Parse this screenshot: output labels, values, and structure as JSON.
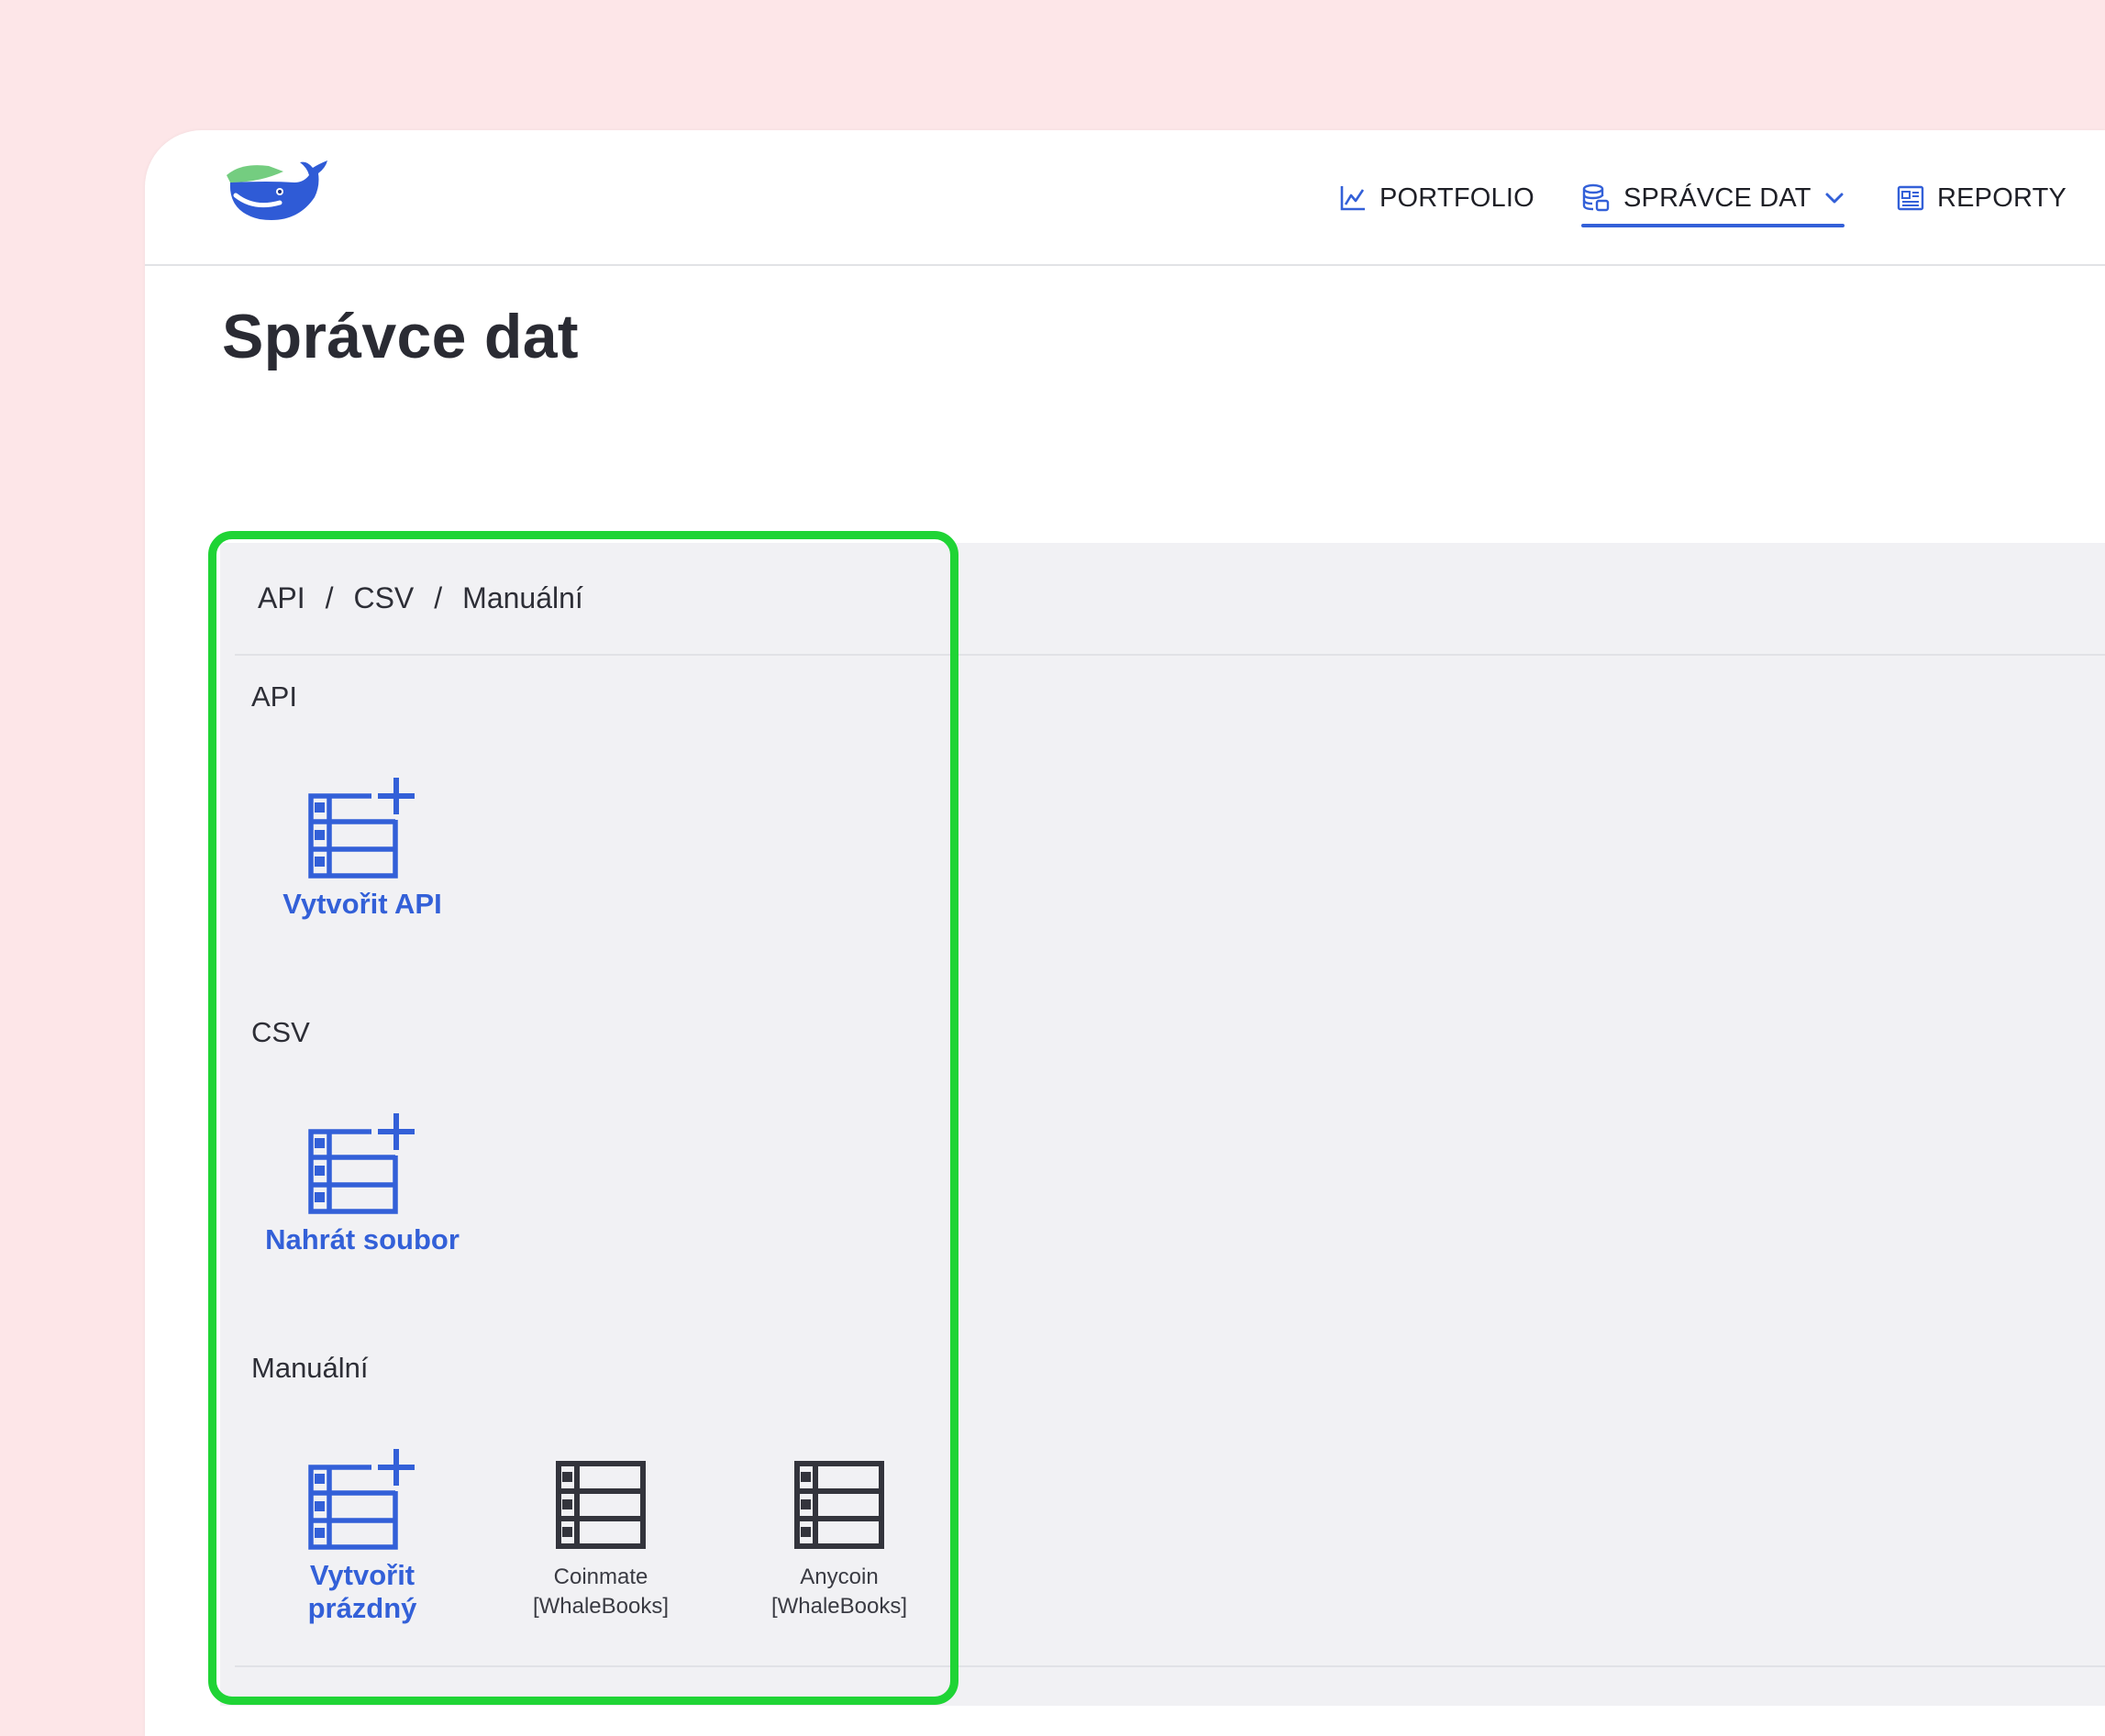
{
  "nav": {
    "items": [
      {
        "label": "PORTFOLIO",
        "icon": "chart-line-icon"
      },
      {
        "label": "SPRÁVCE DAT",
        "icon": "database-icon",
        "active": true
      },
      {
        "label": "REPORTY",
        "icon": "report-icon"
      }
    ]
  },
  "page": {
    "title": "Správce dat"
  },
  "breadcrumb": [
    "API",
    "CSV",
    "Manuální"
  ],
  "sections": {
    "api": {
      "label": "API",
      "tile": "Vytvořit API"
    },
    "csv": {
      "label": "CSV",
      "tile": "Nahrát soubor"
    },
    "manual": {
      "label": "Manuální",
      "tiles": [
        {
          "line1": "Vytvořit",
          "line2": "prázdný"
        },
        {
          "line1": "Coinmate",
          "line2": "[WhaleBooks]"
        },
        {
          "line1": "Anycoin",
          "line2": "[WhaleBooks]"
        }
      ]
    }
  },
  "colors": {
    "accent": "#3360d8",
    "highlight": "#1fd435",
    "background": "#fde6e8",
    "panel": "#f1f1f4"
  }
}
